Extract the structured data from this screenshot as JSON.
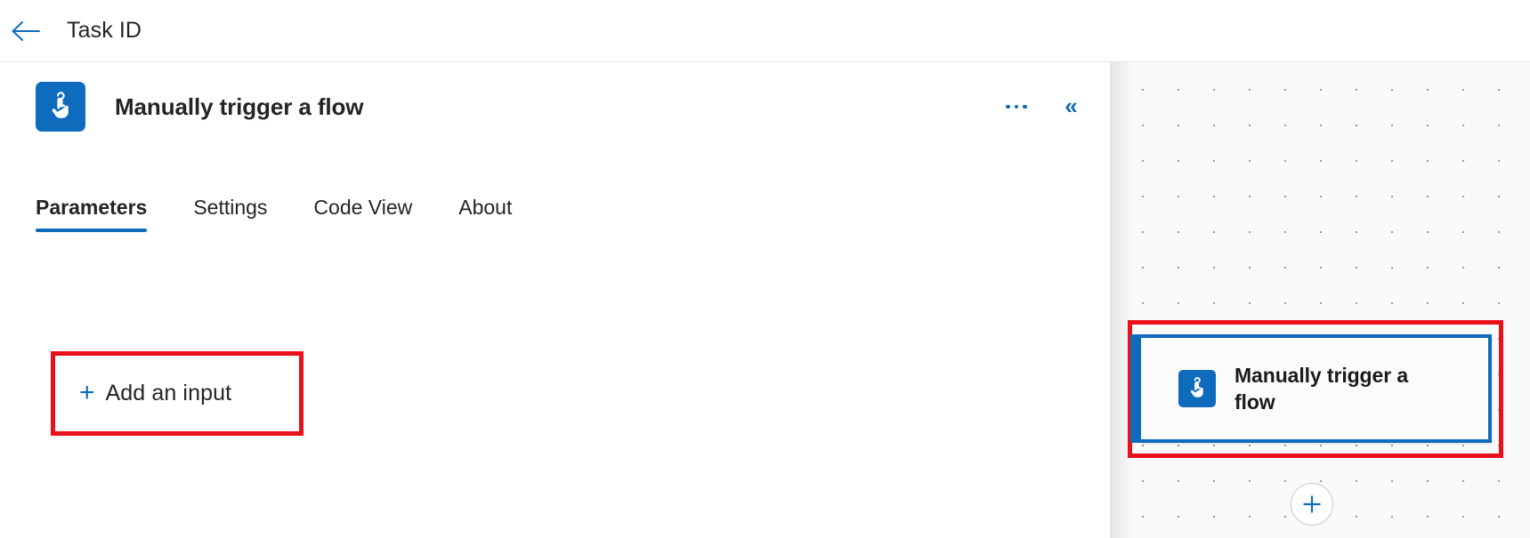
{
  "topbar": {
    "back_icon": "arrow-left-icon",
    "title": "Task ID"
  },
  "panel": {
    "icon": "manual-trigger-tap-icon",
    "title": "Manually trigger a flow",
    "more_actions_icon": "ellipsis-horizontal-icon",
    "more_actions_label": "...",
    "collapse_icon": "chevron-double-left-icon",
    "collapse_label": "«",
    "tabs": [
      {
        "label": "Parameters",
        "active": true
      },
      {
        "label": "Settings",
        "active": false
      },
      {
        "label": "Code View",
        "active": false
      },
      {
        "label": "About",
        "active": false
      }
    ],
    "add_input": {
      "plus_glyph": "+",
      "plus_icon": "plus-icon",
      "label": "Add an input"
    }
  },
  "canvas": {
    "node": {
      "icon": "manual-trigger-tap-icon",
      "label": "Manually trigger a flow"
    },
    "add_node_icon": "plus-circle-icon"
  },
  "colors": {
    "accent_blue": "#0f6cbd",
    "annotation_red": "#e8111c",
    "text_primary": "#242424",
    "canvas_bg": "#fafafa",
    "grid_dot": "#9b9b9b"
  }
}
